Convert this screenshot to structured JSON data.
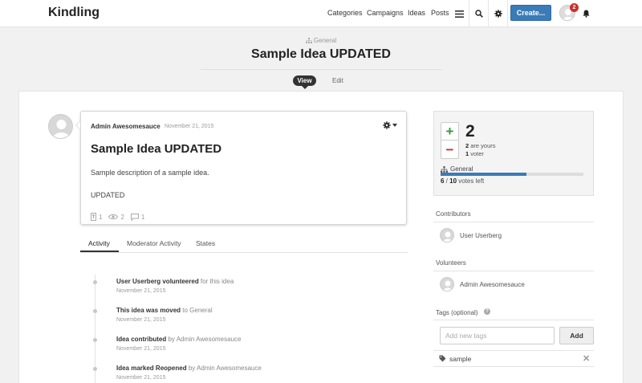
{
  "brand": "Kindling",
  "nav": {
    "categories": "Categories",
    "campaigns": "Campaigns",
    "ideas": "Ideas",
    "posts": "Posts",
    "create": "Create...",
    "notification_count": "2",
    "icons": [
      "menu-icon",
      "search-icon",
      "gear-icon",
      "bell-icon"
    ]
  },
  "header": {
    "category": "General",
    "title": "Sample Idea UPDATED",
    "tabs": {
      "view": "View",
      "edit": "Edit"
    }
  },
  "idea": {
    "author": "Admin Awesomesauce",
    "date": "November 21, 2015",
    "title": "Sample Idea UPDATED",
    "description": "Sample description of a sample idea.",
    "description2": "UPDATED",
    "stats": {
      "contributions": "1",
      "views": "2",
      "comments": "1"
    }
  },
  "activity": {
    "tabs": [
      "Activity",
      "Moderator Activity",
      "States"
    ],
    "active_tab": "Activity",
    "items": [
      {
        "bold": "User Userberg volunteered",
        "rest": " for this idea",
        "date": "November 21, 2015"
      },
      {
        "bold": "This idea was moved",
        "rest": " to General",
        "date": "November 21, 2015"
      },
      {
        "bold": "Idea contributed",
        "rest": " by Admin Awesomesauce",
        "date": "November 21, 2015"
      },
      {
        "bold": "Idea marked Reopened",
        "rest": " by Admin Awesomesauce",
        "date": "November 21, 2015"
      }
    ]
  },
  "votes": {
    "up": "+",
    "down": "−",
    "count": "2",
    "yours_num": "2",
    "yours_label": " are yours",
    "voters_num": "1",
    "voters_label": " voter",
    "category": "General",
    "used": "6",
    "sep": " / ",
    "total": "10",
    "left_label": " votes left",
    "progress_fraction": 0.6,
    "accent_color": "#3a7bb8"
  },
  "contributors": {
    "title": "Contributors",
    "people": [
      "User Userberg"
    ]
  },
  "volunteers": {
    "title": "Volunteers",
    "people": [
      "Admin Awesomesauce"
    ]
  },
  "tags": {
    "title": "Tags (optional)",
    "placeholder": "Add new tags",
    "add": "Add",
    "items": [
      "sample"
    ],
    "remove": "✕"
  }
}
